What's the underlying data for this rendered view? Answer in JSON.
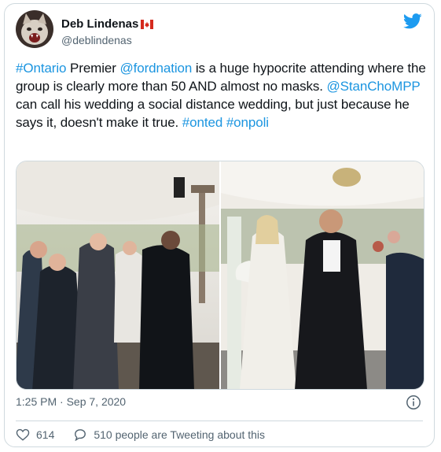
{
  "author": {
    "display_name": "Deb Lindenas",
    "flag_emoji": "🇨🇦",
    "handle": "@deblindenas",
    "avatar_icon": "cat-avatar"
  },
  "tweet": {
    "segments": [
      {
        "text": "#Ontario",
        "type": "link"
      },
      {
        "text": " Premier ",
        "type": "text"
      },
      {
        "text": "@fordnation",
        "type": "link"
      },
      {
        "text": " is a huge hypocrite attending where the group is clearly more than 50 AND almost no masks. ",
        "type": "text"
      },
      {
        "text": "@StanChoMPP",
        "type": "link"
      },
      {
        "text": " can call his wedding a social distance wedding, but just because he says it, doesn't make it true. ",
        "type": "text"
      },
      {
        "text": "#onted",
        "type": "link"
      },
      {
        "text": " ",
        "type": "text"
      },
      {
        "text": "#onpoli",
        "type": "link"
      }
    ]
  },
  "timestamp": "1:25 PM · Sep 7, 2020",
  "actions": {
    "likes": "614",
    "tweeting_text": "510 people are Tweeting about this"
  },
  "colors": {
    "link": "#1b95e0",
    "muted": "#536471",
    "twitter_blue": "#1d9bf0",
    "border": "#cfd9de"
  }
}
